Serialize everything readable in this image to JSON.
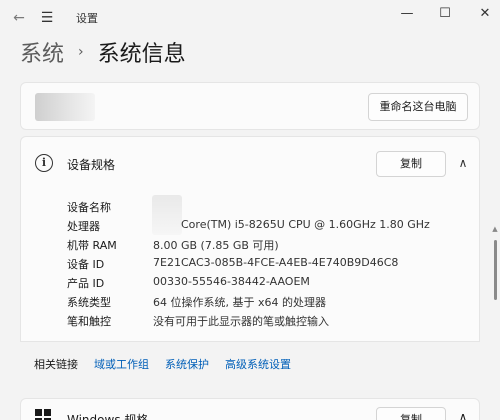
{
  "window": {
    "title": "设置",
    "back_icon": "←",
    "menu_icon": "☰",
    "minimize_icon": "—",
    "maximize_icon": "☐",
    "close_icon": "✕"
  },
  "breadcrumb": {
    "parent": "系统",
    "separator": "›",
    "current": "系统信息"
  },
  "top_card": {
    "rename_label": "重命名这台电脑"
  },
  "device_specs": {
    "title": "设备规格",
    "copy_label": "复制",
    "rows": [
      {
        "key": "设备名称",
        "value": ""
      },
      {
        "key": "处理器",
        "value": "Core(TM) i5-8265U CPU @ 1.60GHz   1.80 GHz"
      },
      {
        "key": "机带 RAM",
        "value": "8.00 GB (7.85 GB 可用)"
      },
      {
        "key": "设备 ID",
        "value": "7E21CAC3-085B-4FCE-A4EB-4E740B9D46C8"
      },
      {
        "key": "产品 ID",
        "value": "00330-55546-38442-AAOEM"
      },
      {
        "key": "系统类型",
        "value": "64 位操作系统, 基于 x64 的处理器"
      },
      {
        "key": "笔和触控",
        "value": "没有可用于此显示器的笔或触控输入"
      }
    ]
  },
  "related": {
    "label": "相关链接",
    "links": [
      "域或工作组",
      "系统保护",
      "高级系统设置"
    ]
  },
  "windows_specs": {
    "title": "Windows 规格",
    "copy_label": "复制"
  },
  "colors": {
    "accent_link": "#005fb8",
    "background": "#f3f3f3",
    "card": "#fbfbfb"
  }
}
